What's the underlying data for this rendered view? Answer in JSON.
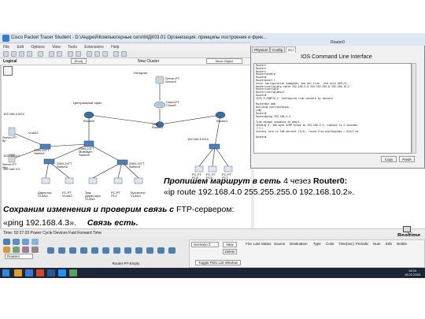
{
  "window": {
    "title": "Cisco Packet Tracer Student - D:\\Андрей\\Компьютерные сети\\МДК03.01 Организация. принципы построения и функ...",
    "menu": [
      "File",
      "Edit",
      "Options",
      "View",
      "Tools",
      "Extensions",
      "Help"
    ]
  },
  "subbar": {
    "logical": "Logical",
    "root": "[Root]",
    "cluster": "New Cluster",
    "move": "Move Object"
  },
  "network": {
    "internet": "Интернет",
    "server_top": "Server-PT Server0",
    "cloud": "Cloud-PT Cloud0",
    "central_office": "Центральный офис",
    "isp_router": "1811 Router2",
    "router_left": "Router0",
    "router_right": "Router1",
    "net_left": "192.168.4.0/24",
    "net_right": "192.168.5.0/24",
    "vlan_label": "VLAN2",
    "switch_main": "2960-24TT Multilayer Switch0",
    "switch_left": "2960-24TT Switch1",
    "server_ftp": "Server-PT ftp",
    "server_http": "Server-PT http",
    "ip_left_top": "192.168.4.2",
    "ip_left_mid": "192.168.4.3",
    "switch_l2": "2960-24TT Switch2",
    "switch_r2": "2960-24TT Switch3",
    "pc_dir": "Директор VLAN2",
    "pc_zam": "Зам. Директора VLAN2",
    "pc_pc1": "PC-PT VLAN2",
    "pc_buh": "Бухгалтер VLAN3",
    "pc_pc2": "PC-PT PC4",
    "pc_r1": "PC-PT PC5",
    "pc_r2": "PC-PT PC6",
    "pc_r3": "PC-PT PC7"
  },
  "cli": {
    "title": "Router0",
    "tabs": [
      "Physical",
      "Config",
      "CLI"
    ],
    "active_tab": "CLI",
    "header": "IOS Command Line Interface",
    "lines": [
      "Router>",
      "Router>",
      "Router>",
      "Router>enable",
      "Router#",
      "Router#conf t",
      "Enter configuration commands, one per line.  End with CNTL/Z.",
      "Router(config)#ip route 192.168.4.0 255.255.255.0 192.168.10.2",
      "Router(config)#",
      "Router(config)#exit",
      "Router#",
      "%SYS-5-CONFIG_I: Configured from console by console",
      "",
      "Router#wr mem",
      "Building configuration...",
      "[OK]",
      "Router#",
      "Router#ping 192.168.4.3",
      "",
      "Type escape sequence to abort.",
      "Sending 5, 100-byte ICMP Echos to 192.168.4.3, timeout is 2 seconds:",
      "!!!!!",
      "Success rate is 100 percent (5/5), round-trip min/avg/max = 0/0/1 ms",
      "",
      "Router#"
    ],
    "copy": "Copy",
    "paste": "Paste"
  },
  "annotation": {
    "line1_bold": "Пропишем маршрут в сеть ",
    "line1_plain": "4 чезез ",
    "line1_router": "Router0:",
    "line2": "«ip route 192.168.4.0 255.255.255.0 192.168.10.2».",
    "line3_bold": "Сохраним изменения и проверим связь с ",
    "line3_plain": "FTP-сервером:",
    "line4_plain": "«ping 192.168.4.3».",
    "line4_bold": "Связь есть."
  },
  "bottom": {
    "time": "Time: 02:27:33   Power Cycle Devices   Fast Forward Time",
    "realtime": "Realtime",
    "category": "Routers",
    "model": "Router-PT-Empty",
    "scenario": "Scenario 0",
    "new": "New",
    "delete": "Delete",
    "toggle": "Toggle PDU List Window",
    "columns": [
      "Fire",
      "Last Status",
      "Source",
      "Destination",
      "Type",
      "Color",
      "Time(sec)",
      "Periodic",
      "Num",
      "Edit",
      "Delete"
    ]
  },
  "taskbar": {
    "time": "16:34",
    "date": "18.02.2020"
  },
  "colors": {
    "title_bar": "#dfe7f1",
    "taskbar": "#1c2636",
    "router": "#3d6ea6",
    "link": "#222222"
  }
}
